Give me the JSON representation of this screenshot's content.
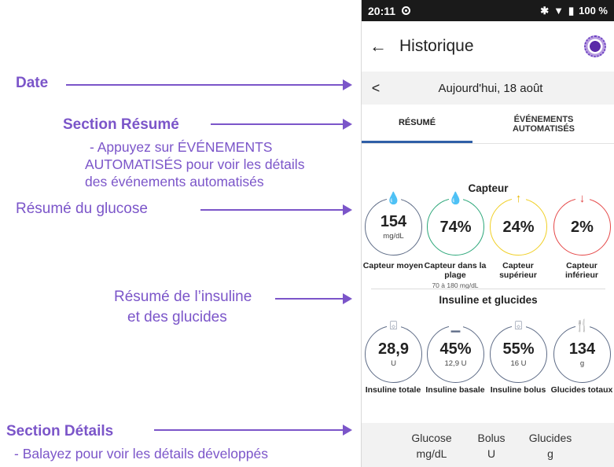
{
  "annotations": {
    "date": "Date",
    "summary_section": "Section Résumé",
    "summary_desc_1": "- Appuyez sur ÉVÉNEMENTS",
    "summary_desc_2": "AUTOMATISÉS pour voir les détails",
    "summary_desc_3": "des événements automatisés",
    "glucose_summary": "Résumé du glucose",
    "insulin_summary_1": "Résumé de l’insuline",
    "insulin_summary_2": "et des glucides",
    "details_section": "Section Détails",
    "details_desc": "- Balayez pour voir les détails développés"
  },
  "status_bar": {
    "time": "20:11",
    "battery": "100 %"
  },
  "app_bar": {
    "back": "←",
    "title": "Historique"
  },
  "date_nav": {
    "prev": "<",
    "date": "Aujourd'hui, 18 août"
  },
  "tabs": [
    {
      "label": "RÉSUMÉ",
      "active": true
    },
    {
      "label": "ÉVÉNEMENTS AUTOMATISÉS",
      "active": false
    }
  ],
  "sensor": {
    "title": "Capteur",
    "items": [
      {
        "value": "154",
        "unit": "mg/dL",
        "label": "Capteur moyen",
        "sub": "",
        "icon": "💧",
        "icon_name": "drop-icon",
        "ring": "#5d6b86",
        "icon_color": "#5d6b86"
      },
      {
        "value": "74%",
        "unit": "",
        "label": "Capteur dans la plage",
        "sub": "70 à 180 mg/dL",
        "icon": "💧",
        "icon_name": "drop-icon",
        "ring": "#2aa678",
        "icon_color": "#1f9c6e"
      },
      {
        "value": "24%",
        "unit": "",
        "label": "Capteur supérieur",
        "sub": "",
        "icon": "↑",
        "icon_name": "arrow-up-icon",
        "ring": "#f0cf24",
        "icon_color": "#e7b800"
      },
      {
        "value": "2%",
        "unit": "",
        "label": "Capteur inférieur",
        "sub": "",
        "icon": "↓",
        "icon_name": "arrow-down-icon",
        "ring": "#e54848",
        "icon_color": "#e04040"
      }
    ]
  },
  "insulin": {
    "title": "Insuline et glucides",
    "items": [
      {
        "value": "28,9",
        "unit": "U",
        "label": "Insuline totale",
        "icon": "⌺",
        "icon_name": "insulin-vial-icon"
      },
      {
        "value": "45%",
        "unit": "12,9 U",
        "label": "Insuline basale",
        "icon": "▁",
        "icon_name": "basal-icon"
      },
      {
        "value": "55%",
        "unit": "16 U",
        "label": "Insuline bolus",
        "icon": "⌺",
        "icon_name": "insulin-vial-icon"
      },
      {
        "value": "134",
        "unit": "g",
        "label": "Glucides totaux",
        "icon": "🍴",
        "icon_name": "fork-knife-icon"
      }
    ]
  },
  "details": {
    "columns": [
      {
        "title": "Glucose",
        "unit": "mg/dL"
      },
      {
        "title": "Bolus",
        "unit": "U"
      },
      {
        "title": "Glucides",
        "unit": "g"
      }
    ]
  },
  "colors": {
    "accent": "#7b55c9",
    "tab_underline": "#2f5fa7",
    "ring_neutral": "#5d6b86"
  }
}
